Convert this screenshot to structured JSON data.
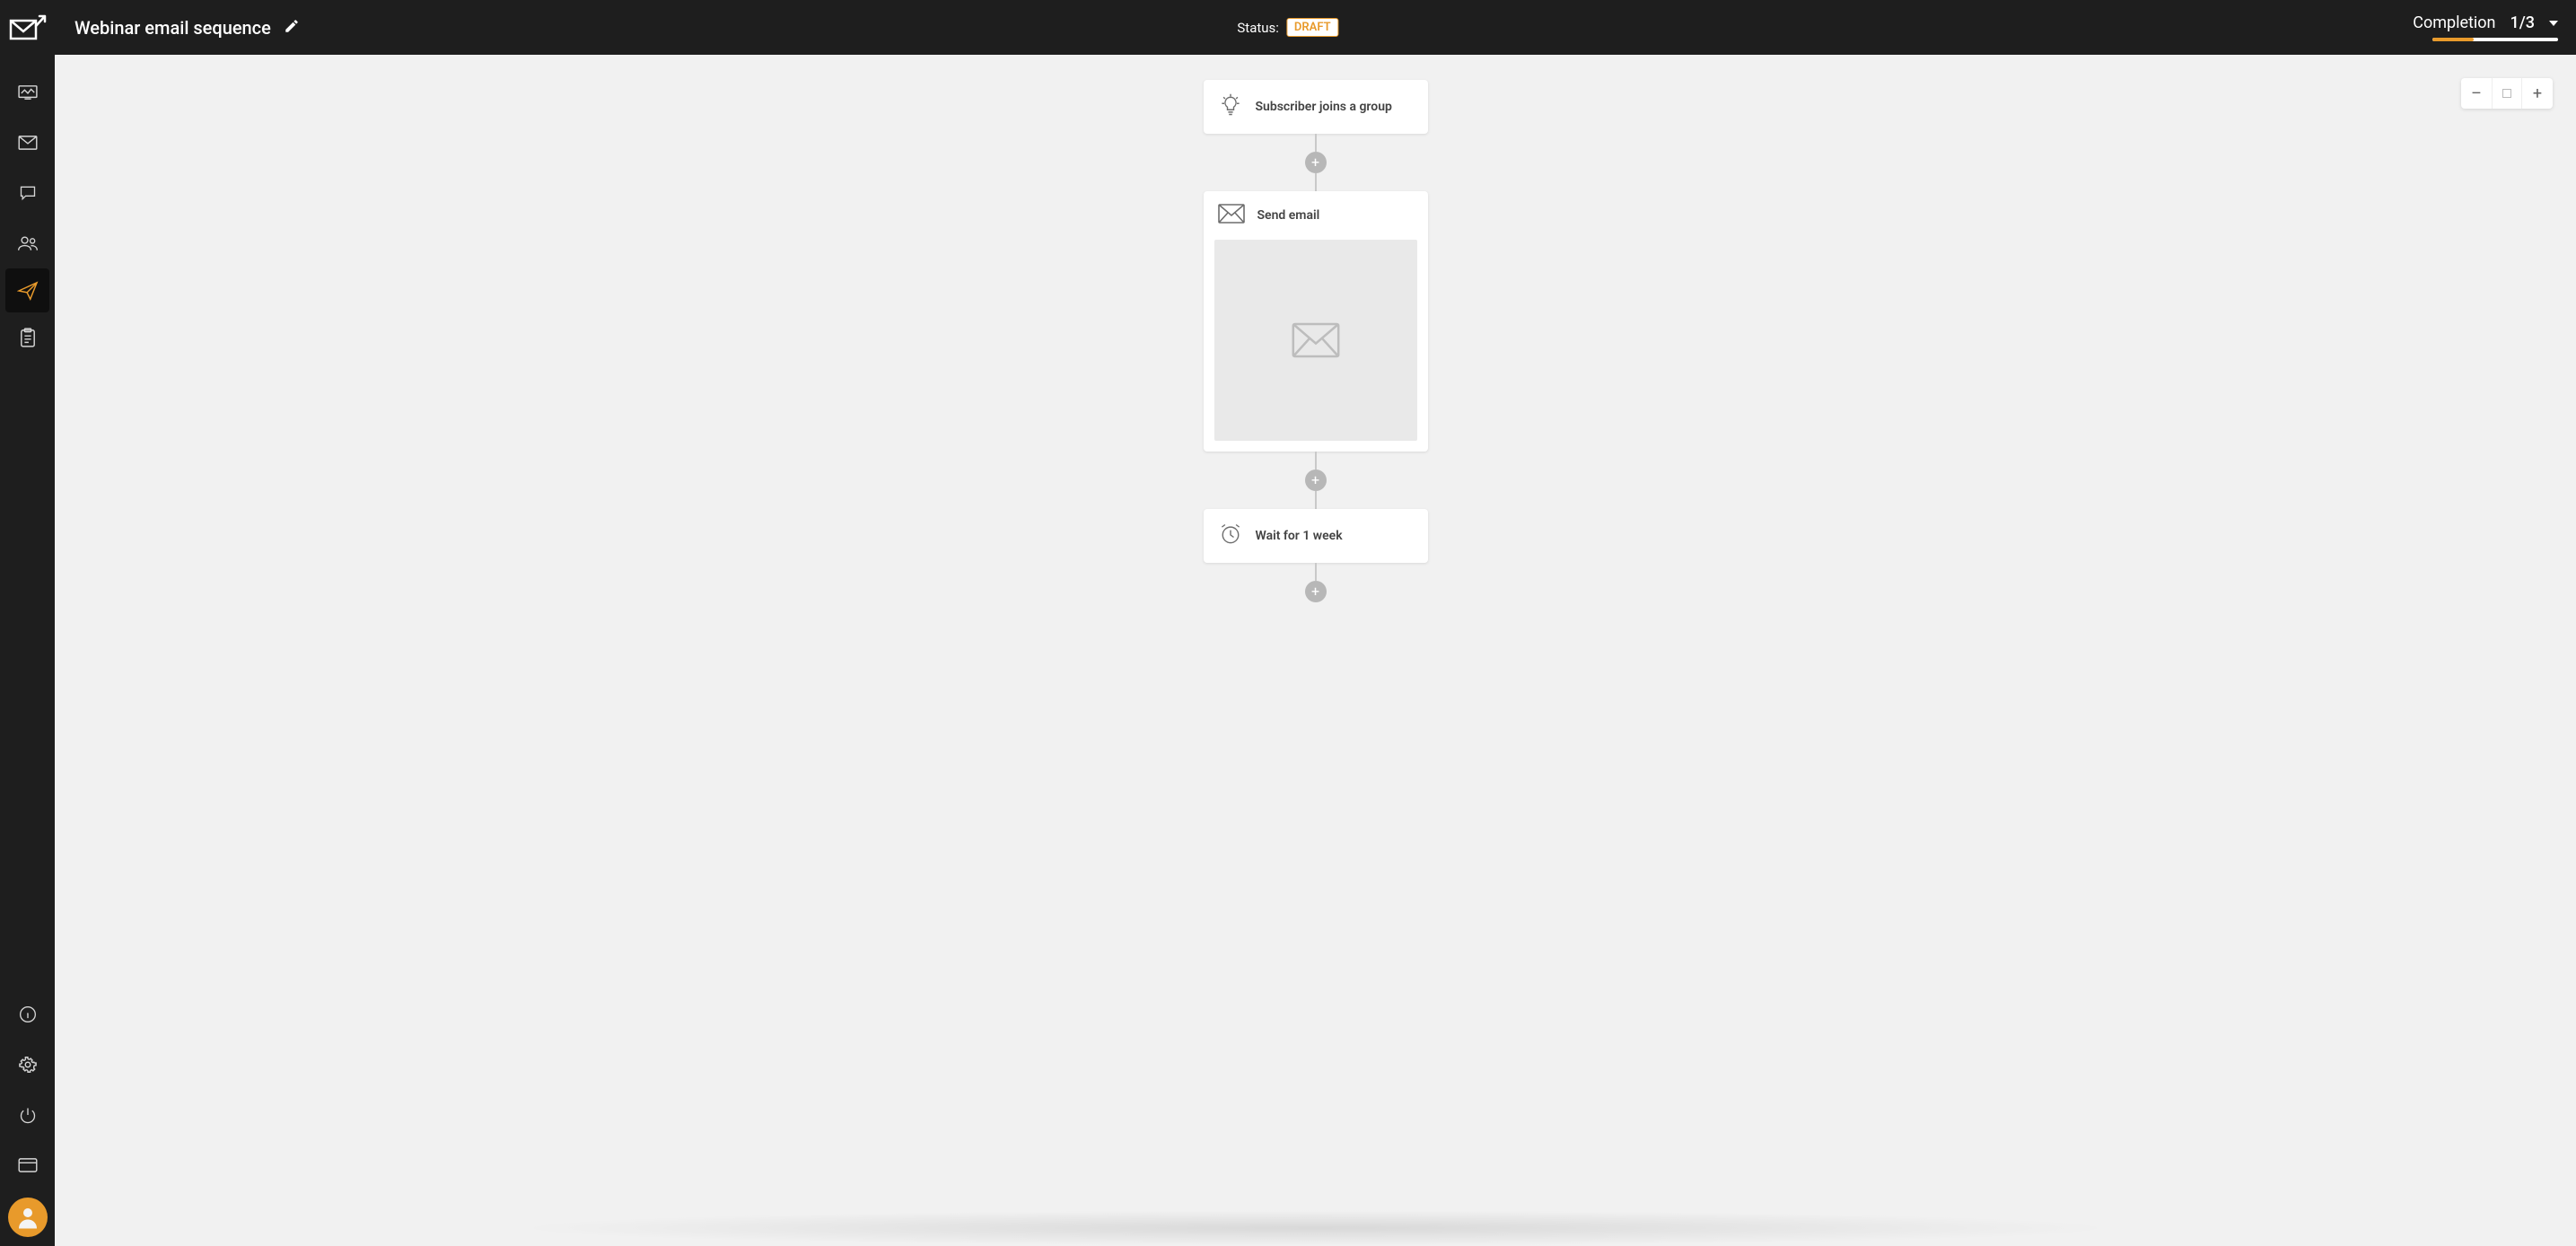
{
  "header": {
    "title": "Webinar email sequence",
    "status_label": "Status:",
    "status_badge": "DRAFT",
    "completion_label": "Completion",
    "completion_done": 1,
    "completion_total": 3,
    "completion_text": "1/3",
    "progress_percent": 33
  },
  "sidebar": {
    "top_items": [
      {
        "name": "dashboard-icon"
      },
      {
        "name": "campaigns-icon"
      },
      {
        "name": "chat-icon"
      },
      {
        "name": "subscribers-icon"
      },
      {
        "name": "automation-icon",
        "active": true
      },
      {
        "name": "forms-icon"
      }
    ],
    "bottom_items": [
      {
        "name": "info-icon"
      },
      {
        "name": "settings-icon"
      },
      {
        "name": "power-icon"
      },
      {
        "name": "billing-icon"
      }
    ]
  },
  "zoom": {
    "minus": "–",
    "plus": "+"
  },
  "flow": {
    "trigger": {
      "label": "Subscriber joins a group"
    },
    "action_email": {
      "label": "Send email"
    },
    "delay": {
      "label": "Wait for 1 week"
    },
    "add_label": "+"
  },
  "colors": {
    "accent": "#e89a2b",
    "dark": "#1e1e1e",
    "canvas": "#f1f1f1"
  }
}
